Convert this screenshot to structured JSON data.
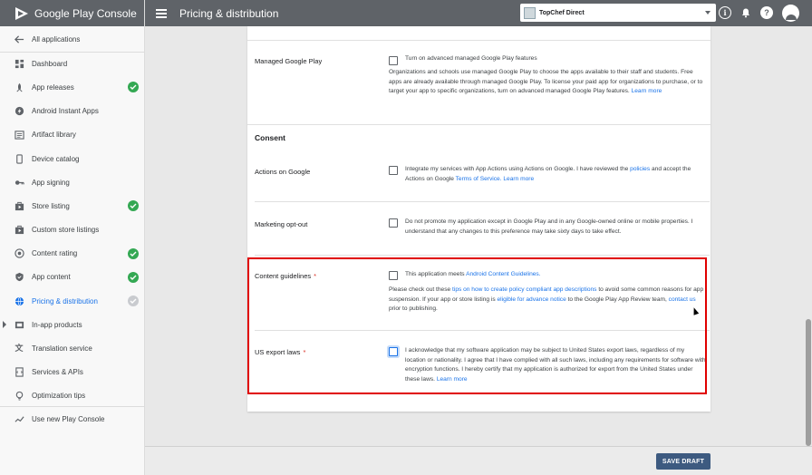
{
  "brand": {
    "name": "Google Play",
    "suffix": "Console"
  },
  "header": {
    "title": "Pricing & distribution",
    "app_name": "TopChef Direct"
  },
  "sidebar": {
    "back_label": "All applications",
    "items": [
      {
        "label": "Dashboard",
        "icon": "dashboard-icon",
        "status": ""
      },
      {
        "label": "App releases",
        "icon": "rocket-icon",
        "status": "complete"
      },
      {
        "label": "Android Instant Apps",
        "icon": "bolt-icon",
        "status": ""
      },
      {
        "label": "Artifact library",
        "icon": "library-icon",
        "status": ""
      },
      {
        "label": "Device catalog",
        "icon": "phone-icon",
        "status": ""
      },
      {
        "label": "App signing",
        "icon": "key-icon",
        "status": ""
      },
      {
        "label": "Store listing",
        "icon": "store-icon",
        "status": "complete"
      },
      {
        "label": "Custom store listings",
        "icon": "store-icon",
        "status": ""
      },
      {
        "label": "Content rating",
        "icon": "rating-icon",
        "status": "complete"
      },
      {
        "label": "App content",
        "icon": "shield-icon",
        "status": "complete"
      },
      {
        "label": "Pricing & distribution",
        "icon": "globe-icon",
        "status": "pending"
      },
      {
        "label": "In-app products",
        "icon": "cart-icon",
        "status": ""
      },
      {
        "label": "Translation service",
        "icon": "translate-icon",
        "status": ""
      },
      {
        "label": "Services & APIs",
        "icon": "api-icon",
        "status": ""
      },
      {
        "label": "Optimization tips",
        "icon": "bulb-icon",
        "status": ""
      }
    ],
    "new_console_label": "Use new Play Console"
  },
  "managed_play": {
    "label": "Managed Google Play",
    "checkbox_label": "Turn on advanced managed Google Play features",
    "description": "Organizations and schools use managed Google Play to choose the apps available to their staff and students. Free apps are already available through managed Google Play. To license your paid app for organizations to purchase, or to target your app to specific organizations, turn on advanced managed Google Play features.",
    "learn_more": "Learn more"
  },
  "consent": {
    "title": "Consent",
    "actions_on_google": {
      "label": "Actions on Google",
      "text_1": "Integrate my services with App Actions using Actions on Google. I have reviewed the",
      "link_policies": "policies",
      "text_2": "and accept the Actions on Google",
      "link_tos": "Terms of Service.",
      "link_learn": "Learn more"
    },
    "marketing_opt_out": {
      "label": "Marketing opt-out",
      "text": "Do not promote my application except in Google Play and in any Google-owned online or mobile properties. I understand that any changes to this preference may take sixty days to take effect."
    },
    "content_guidelines": {
      "label": "Content guidelines",
      "required": "*",
      "checkbox_text": "This application meets",
      "link_guidelines": "Android Content Guidelines.",
      "p1": "Please check out these",
      "link_tips": "tips on how to create policy compliant app descriptions",
      "p2": "to avoid some common reasons for app suspension. If your app or store listing is",
      "link_eligible": "eligible for advance notice",
      "p3": "to the Google Play App Review team,",
      "link_contact": "contact us",
      "p4": "prior to publishing."
    },
    "us_export": {
      "label": "US export laws",
      "required": "*",
      "text": "I acknowledge that my software application may be subject to United States export laws, regardless of my location or nationality. I agree that I have complied with all such laws, including any requirements for software with encryption functions. I hereby certify that my application is authorized for export from the United States under these laws.",
      "link_learn": "Learn more"
    }
  },
  "footer": {
    "save_label": "SAVE DRAFT"
  },
  "colors": {
    "accent": "#1a73e8",
    "check": "#34a853",
    "highlight": "#e00000",
    "topbar": "#5f6368",
    "save": "#3d5a80"
  }
}
